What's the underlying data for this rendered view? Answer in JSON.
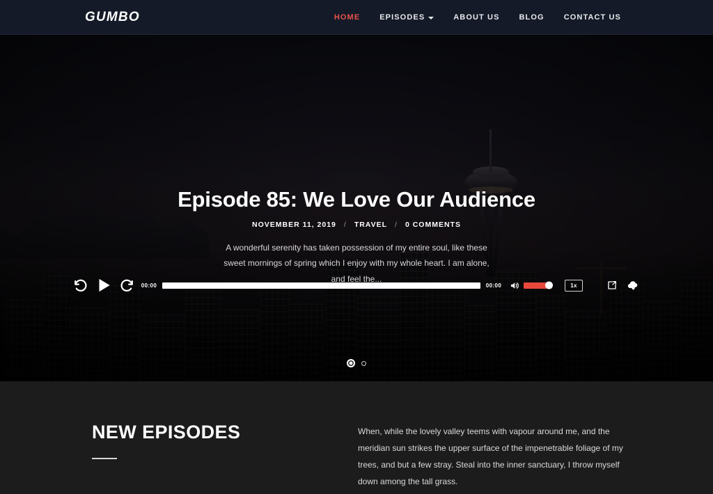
{
  "header": {
    "brand": "GUMBO",
    "nav": [
      {
        "label": "HOME",
        "active": true,
        "dropdown": false,
        "name": "nav-home"
      },
      {
        "label": "EPISODES",
        "active": false,
        "dropdown": true,
        "name": "nav-episodes"
      },
      {
        "label": "ABOUT US",
        "active": false,
        "dropdown": false,
        "name": "nav-about-us"
      },
      {
        "label": "BLOG",
        "active": false,
        "dropdown": false,
        "name": "nav-blog"
      },
      {
        "label": "CONTACT US",
        "active": false,
        "dropdown": false,
        "name": "nav-contact-us"
      }
    ]
  },
  "hero": {
    "title": "Episode 85: We Love Our Audience",
    "meta": {
      "date": "NOVEMBER 11, 2019",
      "separator": "/",
      "category": "TRAVEL",
      "comments": "0 COMMENTS"
    },
    "excerpt": "A wonderful serenity has taken possession of my entire soul, like these sweet mornings of spring which I enjoy with my whole heart. I am alone, and feel the...",
    "image_description": "Seattle skyline with the Space Needle at dusk, darkened overlay"
  },
  "player": {
    "rewind_icon": "rewind-15-icon",
    "play_icon": "play-icon",
    "forward_icon": "forward-15-icon",
    "current_time": "00:00",
    "duration": "00:00",
    "progress_percent": 0,
    "volume_icon": "volume-icon",
    "volume_percent": 100,
    "speed_label": "1x",
    "share_icon": "share-icon",
    "download_icon": "cloud-download-icon",
    "accent_color": "#e8483c",
    "track_color": "#ffffff"
  },
  "carousel": {
    "dots": [
      {
        "active": true,
        "name": "carousel-dot-1"
      },
      {
        "active": false,
        "name": "carousel-dot-2"
      }
    ]
  },
  "episodes": {
    "heading": "NEW EPISODES",
    "description": "When, while the lovely valley teems with vapour around me, and the meridian sun strikes the upper surface of the impenetrable foliage of my trees, and but a few stray. Steal into the inner sanctuary, I throw myself down among the tall grass."
  },
  "colors": {
    "header_bg": "#141a28",
    "accent": "#e8524a",
    "section_bg": "#1c1c1c",
    "text": "#ffffff"
  }
}
